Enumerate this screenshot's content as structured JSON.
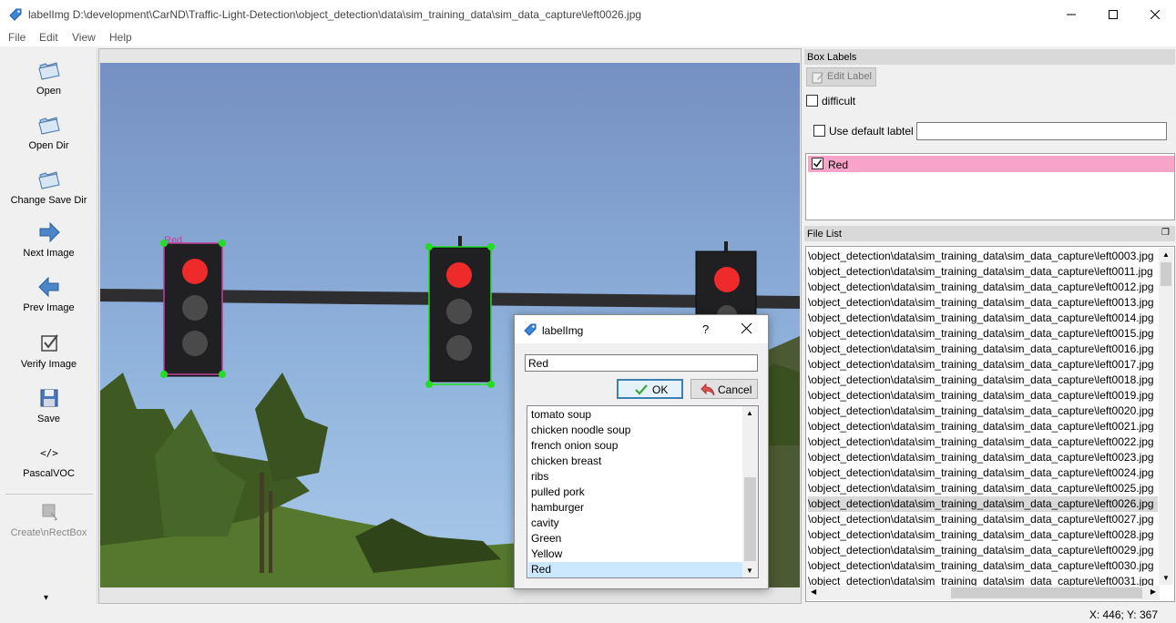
{
  "window": {
    "title": "labelImg D:\\development\\CarND\\Traffic-Light-Detection\\object_detection\\data\\sim_training_data\\sim_data_capture\\left0026.jpg"
  },
  "menu": [
    "File",
    "Edit",
    "View",
    "Help"
  ],
  "toolbar": {
    "open": "Open",
    "open_dir": "Open Dir",
    "change_save_dir": "Change Save Dir",
    "next_image": "Next Image",
    "prev_image": "Prev Image",
    "verify_image": "Verify Image",
    "save": "Save",
    "format": "PascalVOC",
    "create_rect": "Create\\nRectBox"
  },
  "canvas": {
    "box_label": "Red"
  },
  "box_labels_dock": {
    "title": "Box Labels",
    "edit_label": "Edit Label",
    "difficult": "difficult",
    "use_default_label": "Use default labtel",
    "default_label_value": "",
    "labels": [
      {
        "text": "Red",
        "checked": true,
        "color": "#f8a3c8"
      }
    ]
  },
  "file_list_dock": {
    "title": "File List",
    "files": [
      "\\object_detection\\data\\sim_training_data\\sim_data_capture\\left0003.jpg",
      "\\object_detection\\data\\sim_training_data\\sim_data_capture\\left0011.jpg",
      "\\object_detection\\data\\sim_training_data\\sim_data_capture\\left0012.jpg",
      "\\object_detection\\data\\sim_training_data\\sim_data_capture\\left0013.jpg",
      "\\object_detection\\data\\sim_training_data\\sim_data_capture\\left0014.jpg",
      "\\object_detection\\data\\sim_training_data\\sim_data_capture\\left0015.jpg",
      "\\object_detection\\data\\sim_training_data\\sim_data_capture\\left0016.jpg",
      "\\object_detection\\data\\sim_training_data\\sim_data_capture\\left0017.jpg",
      "\\object_detection\\data\\sim_training_data\\sim_data_capture\\left0018.jpg",
      "\\object_detection\\data\\sim_training_data\\sim_data_capture\\left0019.jpg",
      "\\object_detection\\data\\sim_training_data\\sim_data_capture\\left0020.jpg",
      "\\object_detection\\data\\sim_training_data\\sim_data_capture\\left0021.jpg",
      "\\object_detection\\data\\sim_training_data\\sim_data_capture\\left0022.jpg",
      "\\object_detection\\data\\sim_training_data\\sim_data_capture\\left0023.jpg",
      "\\object_detection\\data\\sim_training_data\\sim_data_capture\\left0024.jpg",
      "\\object_detection\\data\\sim_training_data\\sim_data_capture\\left0025.jpg",
      "\\object_detection\\data\\sim_training_data\\sim_data_capture\\left0026.jpg",
      "\\object_detection\\data\\sim_training_data\\sim_data_capture\\left0027.jpg",
      "\\object_detection\\data\\sim_training_data\\sim_data_capture\\left0028.jpg",
      "\\object_detection\\data\\sim_training_data\\sim_data_capture\\left0029.jpg",
      "\\object_detection\\data\\sim_training_data\\sim_data_capture\\left0030.jpg",
      "\\object_detection\\data\\sim_training_data\\sim_data_capture\\left0031.jpg"
    ],
    "selected_index": 16
  },
  "dialog": {
    "title": "labelImg",
    "help": "?",
    "input_value": "Red",
    "ok": "OK",
    "cancel": "Cancel",
    "options": [
      "tomato soup",
      "chicken noodle soup",
      "french onion soup",
      "chicken breast",
      "ribs",
      "pulled pork",
      "hamburger",
      "cavity",
      "Green",
      "Yellow",
      "Red"
    ],
    "selected_index": 10
  },
  "status": {
    "cursor": "X: 446; Y: 367"
  }
}
